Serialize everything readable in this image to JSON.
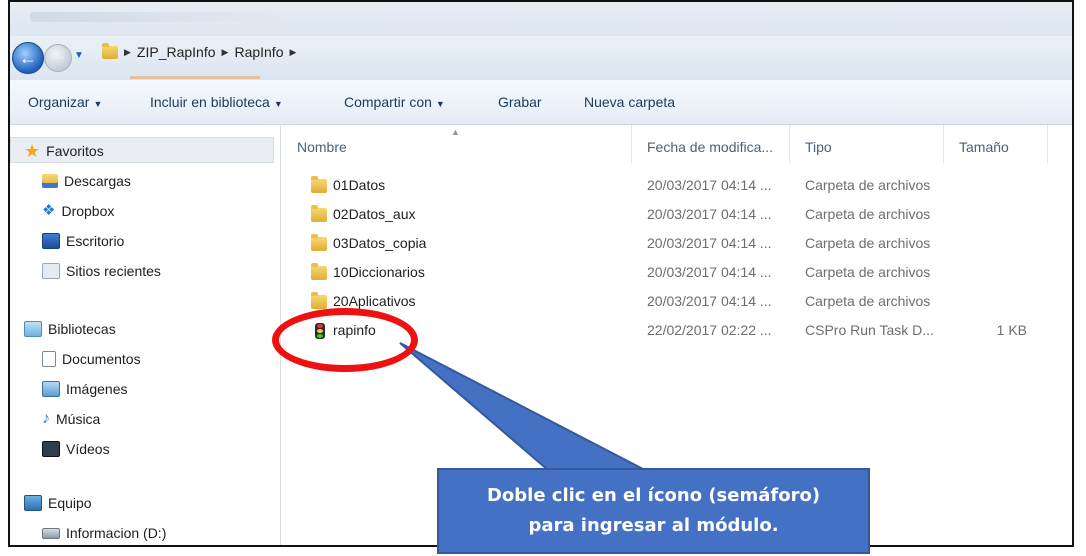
{
  "address": {
    "crumbs": [
      "ZIP_RapInfo",
      "RapInfo"
    ]
  },
  "toolbar": {
    "organize": "Organizar",
    "include_library": "Incluir en biblioteca",
    "share": "Compartir con",
    "burn": "Grabar",
    "new_folder": "Nueva carpeta"
  },
  "nav": {
    "favorites": "Favoritos",
    "downloads": "Descargas",
    "dropbox": "Dropbox",
    "desktop": "Escritorio",
    "recent": "Sitios recientes",
    "libraries": "Bibliotecas",
    "documents": "Documentos",
    "pictures": "Imágenes",
    "music": "Música",
    "videos": "Vídeos",
    "computer": "Equipo",
    "drive": "Informacion (D:)"
  },
  "columns": {
    "name": "Nombre",
    "date": "Fecha de modifica...",
    "type": "Tipo",
    "size": "Tamaño"
  },
  "files": [
    {
      "name": "01Datos",
      "date": "20/03/2017 04:14 ...",
      "type": "Carpeta de archivos",
      "size": ""
    },
    {
      "name": "02Datos_aux",
      "date": "20/03/2017 04:14 ...",
      "type": "Carpeta de archivos",
      "size": ""
    },
    {
      "name": "03Datos_copia",
      "date": "20/03/2017 04:14 ...",
      "type": "Carpeta de archivos",
      "size": ""
    },
    {
      "name": "10Diccionarios",
      "date": "20/03/2017 04:14 ...",
      "type": "Carpeta de archivos",
      "size": ""
    },
    {
      "name": "20Aplicativos",
      "date": "20/03/2017 04:14 ...",
      "type": "Carpeta de archivos",
      "size": ""
    },
    {
      "name": "rapinfo",
      "date": "22/02/2017 02:22 ...",
      "type": "CSPro Run Task D...",
      "size": "1 KB"
    }
  ],
  "callout": {
    "line1": "Doble clic en el ícono (semáforo)",
    "line2": "para ingresar al módulo."
  },
  "colors": {
    "ring": "#ee1111",
    "callout_bg": "#4471c4"
  }
}
